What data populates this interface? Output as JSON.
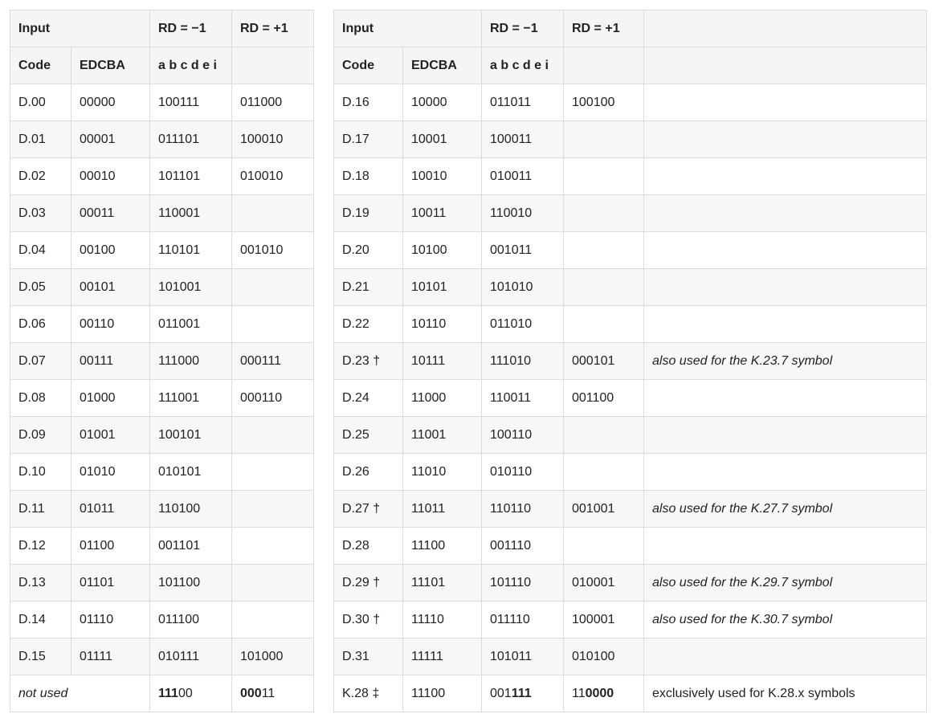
{
  "left": {
    "header1": [
      "Input",
      "RD = −1",
      "RD = +1"
    ],
    "header2": [
      "Code",
      "EDCBA",
      "a b c d e i"
    ],
    "rows": [
      [
        "D.00",
        "00000",
        "100111",
        "011000"
      ],
      [
        "D.01",
        "00001",
        "011101",
        "100010"
      ],
      [
        "D.02",
        "00010",
        "101101",
        "010010"
      ],
      [
        "D.03",
        "00011",
        "110001",
        ""
      ],
      [
        "D.04",
        "00100",
        "110101",
        "001010"
      ],
      [
        "D.05",
        "00101",
        "101001",
        ""
      ],
      [
        "D.06",
        "00110",
        "011001",
        ""
      ],
      [
        "D.07",
        "00111",
        "111000",
        "000111"
      ],
      [
        "D.08",
        "01000",
        "111001",
        "000110"
      ],
      [
        "D.09",
        "01001",
        "100101",
        ""
      ],
      [
        "D.10",
        "01010",
        "010101",
        ""
      ],
      [
        "D.11",
        "01011",
        "110100",
        ""
      ],
      [
        "D.12",
        "01100",
        "001101",
        ""
      ],
      [
        "D.13",
        "01101",
        "101100",
        ""
      ],
      [
        "D.14",
        "01110",
        "011100",
        ""
      ],
      [
        "D.15",
        "01111",
        "010111",
        "101000"
      ]
    ],
    "last": {
      "label": "not used",
      "rdm_bold": "111",
      "rdm_rest": "00",
      "rdp_bold": "000",
      "rdp_rest": "11"
    }
  },
  "right": {
    "header1": [
      "Input",
      "RD = −1",
      "RD = +1"
    ],
    "header2": [
      "Code",
      "EDCBA",
      "a b c d e i"
    ],
    "rows": [
      [
        "D.16",
        "10000",
        "011011",
        "100100",
        ""
      ],
      [
        "D.17",
        "10001",
        "100011",
        "",
        ""
      ],
      [
        "D.18",
        "10010",
        "010011",
        "",
        ""
      ],
      [
        "D.19",
        "10011",
        "110010",
        "",
        ""
      ],
      [
        "D.20",
        "10100",
        "001011",
        "",
        ""
      ],
      [
        "D.21",
        "10101",
        "101010",
        "",
        ""
      ],
      [
        "D.22",
        "10110",
        "011010",
        "",
        ""
      ],
      [
        "D.23 †",
        "10111",
        "111010",
        "000101",
        "also used for the K.23.7 symbol"
      ],
      [
        "D.24",
        "11000",
        "110011",
        "001100",
        ""
      ],
      [
        "D.25",
        "11001",
        "100110",
        "",
        ""
      ],
      [
        "D.26",
        "11010",
        "010110",
        "",
        ""
      ],
      [
        "D.27 †",
        "11011",
        "110110",
        "001001",
        "also used for the K.27.7 symbol"
      ],
      [
        "D.28",
        "11100",
        "001110",
        "",
        ""
      ],
      [
        "D.29 †",
        "11101",
        "101110",
        "010001",
        "also used for the K.29.7 symbol"
      ],
      [
        "D.30 †",
        "11110",
        "011110",
        "100001",
        "also used for the K.30.7 symbol"
      ],
      [
        "D.31",
        "11111",
        "101011",
        "010100",
        ""
      ]
    ],
    "last": {
      "code": "K.28 ‡",
      "edcba": "11100",
      "rdm_pre": "001",
      "rdm_bold": "111",
      "rdp_pre": "11",
      "rdp_bold": "0000",
      "note": "exclusively used for K.28.x symbols"
    }
  }
}
